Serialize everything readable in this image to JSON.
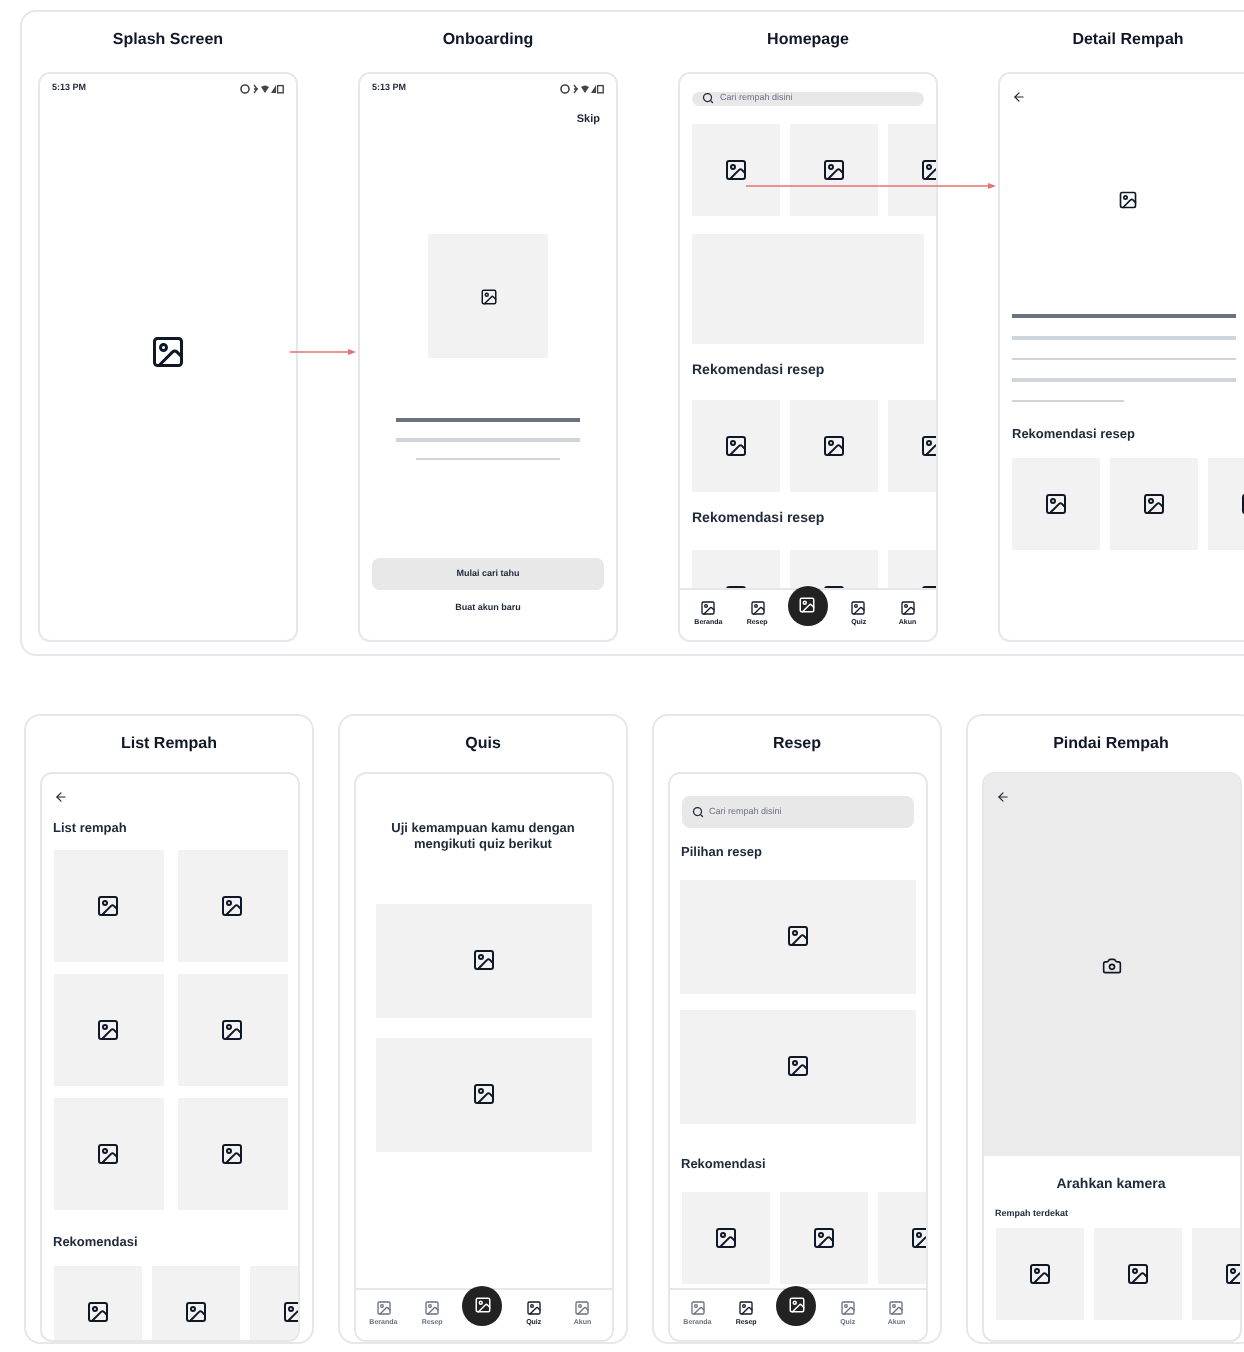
{
  "top_board": {
    "screens": [
      {
        "title": "Splash Screen",
        "kind": "splash",
        "status_time": "5:13 PM"
      },
      {
        "title": "Onboarding",
        "kind": "onboarding",
        "status_time": "5:13 PM",
        "skip": "Skip",
        "primary_button": "Mulai cari tahu",
        "secondary_link": "Buat akun baru"
      },
      {
        "title": "Homepage",
        "kind": "home",
        "search_placeholder": "Cari rempah disini",
        "sections": [
          "Rekomendasi resep",
          "Rekomendasi resep"
        ],
        "nav": [
          {
            "label": "Beranda",
            "selected": true
          },
          {
            "label": "Resep",
            "selected": true
          },
          {
            "label": "Quiz",
            "selected": true
          },
          {
            "label": "Akun",
            "selected": true
          }
        ]
      },
      {
        "title": "Detail Rempah",
        "kind": "detail",
        "section": "Rekomendasi resep"
      }
    ]
  },
  "bottom_board": {
    "screens": [
      {
        "title": "List Rempah",
        "kind": "list",
        "heading": "List rempah",
        "section": "Rekomendasi"
      },
      {
        "title": "Quis",
        "kind": "quiz",
        "prompt": "Uji kemampuan kamu dengan mengikuti quiz berikut",
        "nav": [
          {
            "label": "Beranda",
            "selected": false
          },
          {
            "label": "Resep",
            "selected": false
          },
          {
            "label": "Quiz",
            "selected": true
          },
          {
            "label": "Akun",
            "selected": false
          }
        ]
      },
      {
        "title": "Resep",
        "kind": "recipes",
        "search_placeholder": "Cari rempah disini",
        "heading": "Pilihan resep",
        "section": "Rekomendasi",
        "nav": [
          {
            "label": "Beranda",
            "selected": false
          },
          {
            "label": "Resep",
            "selected": true
          },
          {
            "label": "Quiz",
            "selected": false
          },
          {
            "label": "Akun",
            "selected": false
          }
        ]
      },
      {
        "title": "Pindai Rempah",
        "kind": "scan",
        "caption": "Arahkan kamera",
        "section": "Rempah terdekat"
      }
    ]
  }
}
